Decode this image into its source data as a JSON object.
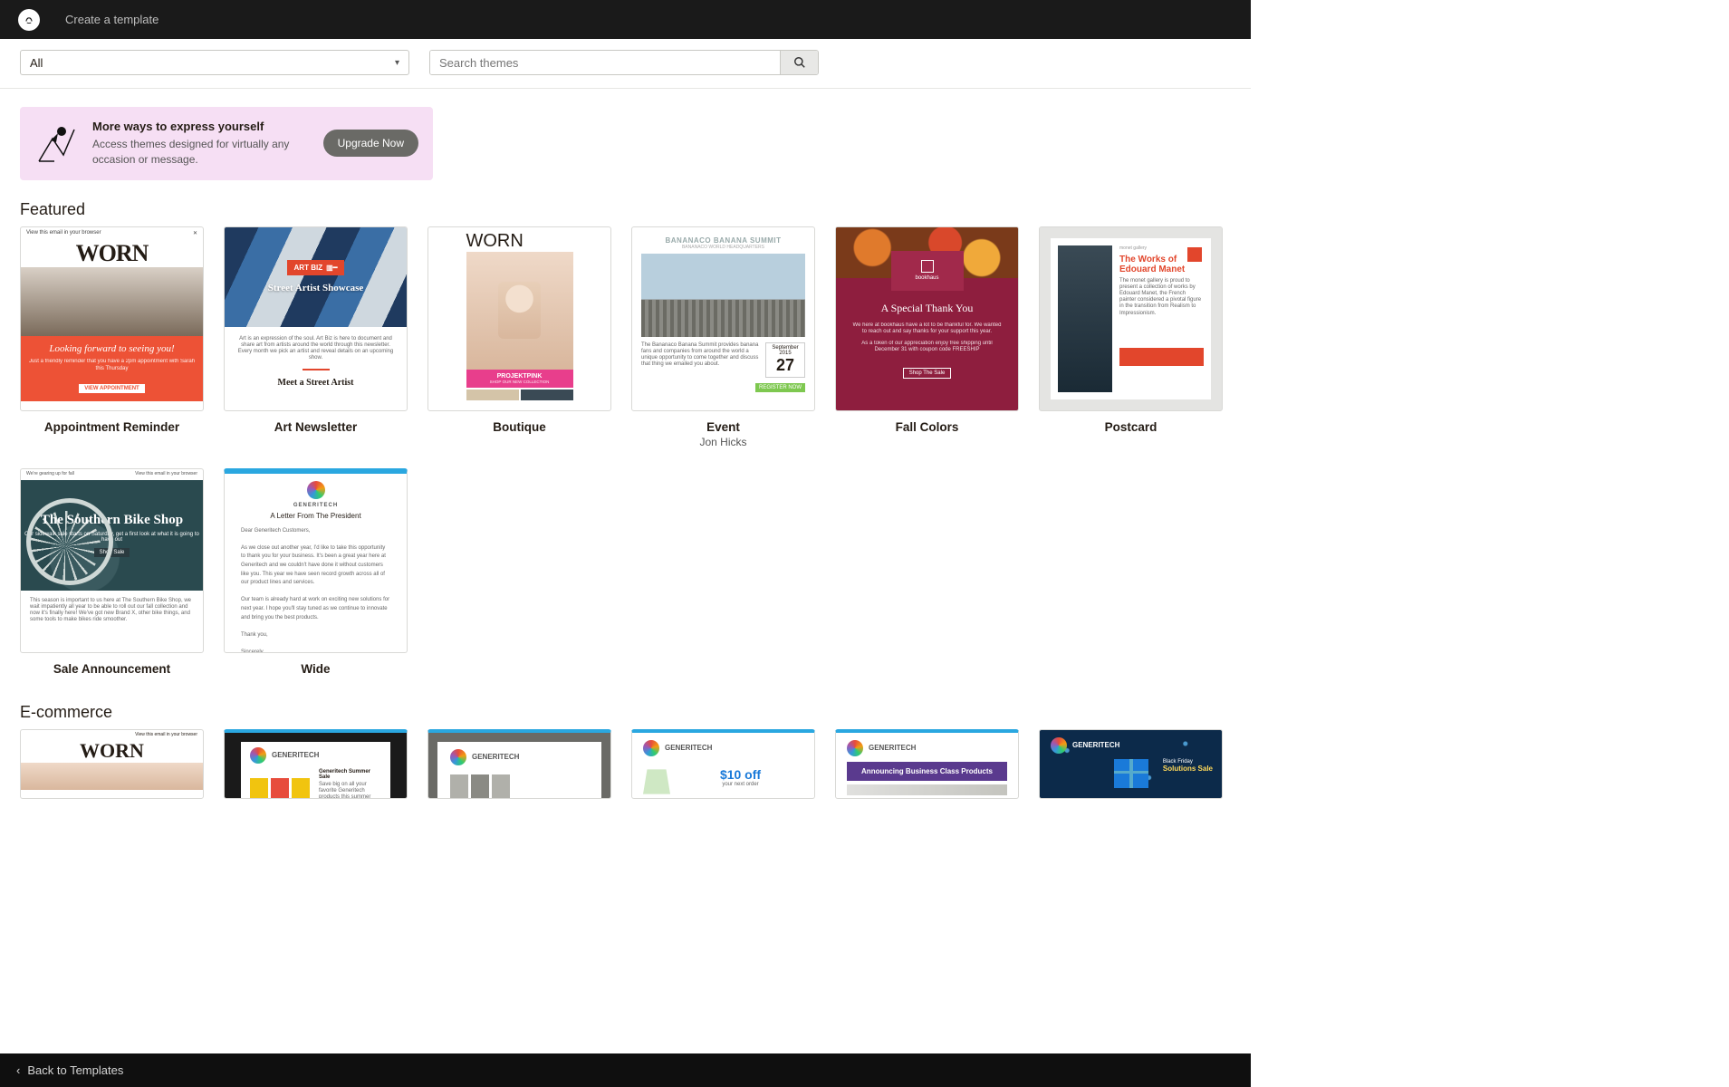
{
  "header": {
    "page_title": "Create a template"
  },
  "filters": {
    "category": "All",
    "search_placeholder": "Search themes"
  },
  "upsell": {
    "title": "More ways to express yourself",
    "subtitle": "Access themes designed for virtually any occasion or message.",
    "cta": "Upgrade Now"
  },
  "sections": {
    "featured": "Featured",
    "ecommerce": "E-commerce"
  },
  "featured": [
    {
      "name": "Appointment Reminder"
    },
    {
      "name": "Art Newsletter"
    },
    {
      "name": "Boutique"
    },
    {
      "name": "Event",
      "author": "Jon Hicks"
    },
    {
      "name": "Fall Colors"
    },
    {
      "name": "Postcard"
    },
    {
      "name": "Sale Announcement"
    },
    {
      "name": "Wide"
    }
  ],
  "thumb_text": {
    "worn_logo": "WORN",
    "appt_headline": "Looking forward to seeing you!",
    "appt_sub": "Just a friendly reminder that you have a 2pm appointment with Sarah this Thursday",
    "appt_btn": "VIEW APPOINTMENT",
    "art_badge": "ART BIZ",
    "art_hero": "Street Artist Showcase",
    "art_meet": "Meet a Street Artist",
    "boutique_brand": "PROJEKTPINK",
    "event_h1": "BANANACO BANANA SUMMIT",
    "event_h2": "BANANACO WORLD HEADQUARTERS",
    "event_month": "September 2015",
    "event_day": "27",
    "event_btn": "REGISTER NOW",
    "fall_brand": "bookhaus",
    "fall_thank": "A Special Thank You",
    "fall_btn": "Shop The Sale",
    "post_gallery": "monet gallery",
    "post_title": "The Works of Edouard Manet",
    "bike_title": "The Southern Bike Shop",
    "bike_sub": "Our sidewalk sale starts on Saturday, get a first look at what it is going to have out",
    "bike_btn": "Shop Sale",
    "wide_brand": "GENERITECH",
    "wide_letter": "A Letter From The President",
    "e4_off": "$10 off",
    "e5_announce": "Announcing Business Class Products",
    "e6_bf": "Black Friday",
    "e6_sale": "Solutions Sale"
  },
  "footer": {
    "back": "Back to Templates"
  }
}
